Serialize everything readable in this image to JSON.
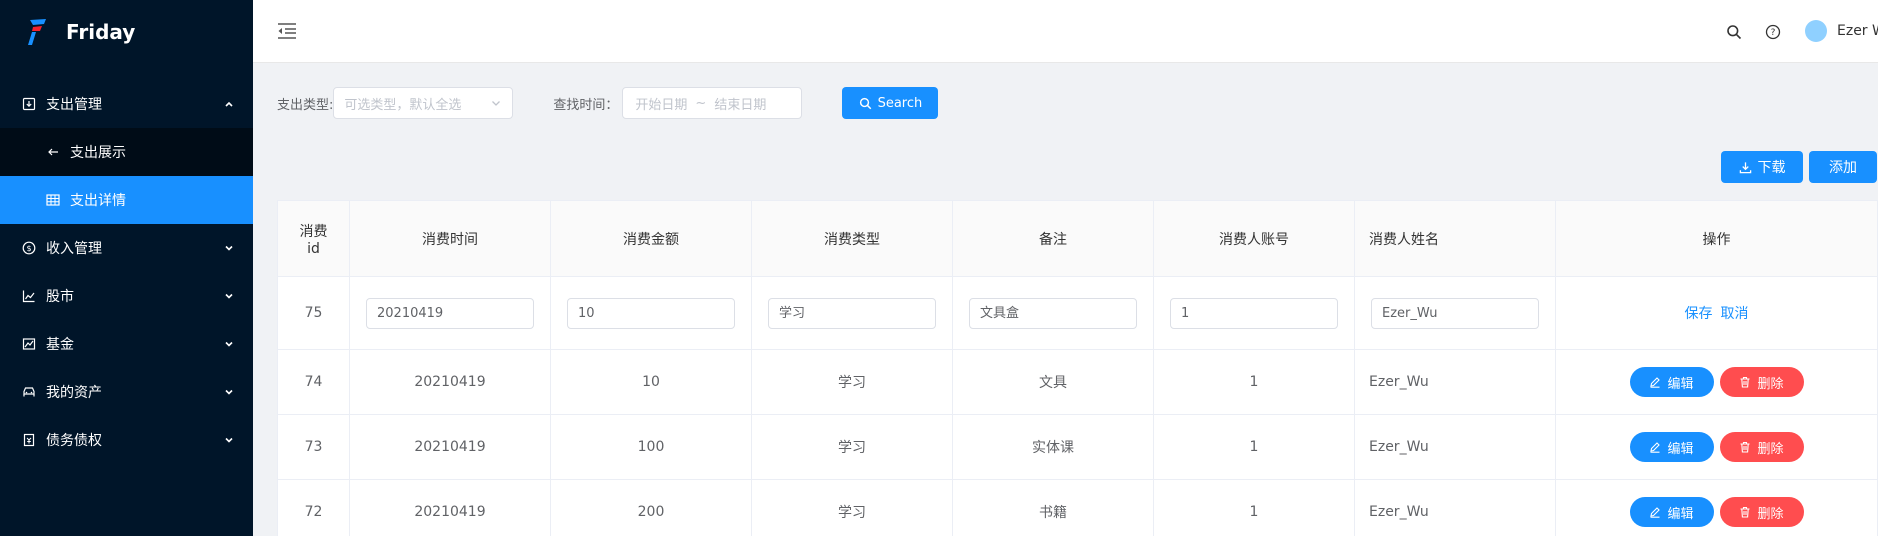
{
  "app": {
    "name": "Friday"
  },
  "sidebar": {
    "items": [
      {
        "label": "支出管理",
        "icon": "export-icon",
        "expanded": true,
        "children": [
          {
            "label": "支出展示",
            "icon": "arrow-left-icon"
          },
          {
            "label": "支出详情",
            "icon": "table-icon",
            "active": true
          }
        ]
      },
      {
        "label": "收入管理",
        "icon": "dollar-icon"
      },
      {
        "label": "股市",
        "icon": "line-chart-icon"
      },
      {
        "label": "基金",
        "icon": "area-chart-icon"
      },
      {
        "label": "我的资产",
        "icon": "car-icon"
      },
      {
        "label": "债务债权",
        "icon": "account-book-icon"
      }
    ]
  },
  "header": {
    "user": "Ezer Wu"
  },
  "filters": {
    "type_label": "支出类型:",
    "type_placeholder": "可选类型，默认全选",
    "time_label": "查找时间：",
    "start_placeholder": "开始日期",
    "separator": "~",
    "end_placeholder": "结束日期",
    "search_label": "Search"
  },
  "actions": {
    "download_label": "下载",
    "add_label": "添加"
  },
  "table": {
    "headers": [
      "消费id",
      "消费时间",
      "消费金额",
      "消费类型",
      "备注",
      "消费人账号",
      "消费人姓名",
      "操作"
    ],
    "header_id_line1": "消费",
    "header_id_line2": "id",
    "edit_row": {
      "id": "75",
      "time": "20210419",
      "amount": "10",
      "type": "学习",
      "note": "文具盒",
      "account": "1",
      "name": "Ezer_Wu",
      "save": "保存",
      "cancel": "取消"
    },
    "rows": [
      {
        "id": "74",
        "time": "20210419",
        "amount": "10",
        "type": "学习",
        "note": "文具",
        "account": "1",
        "name": "Ezer_Wu"
      },
      {
        "id": "73",
        "time": "20210419",
        "amount": "100",
        "type": "学习",
        "note": "实体课",
        "account": "1",
        "name": "Ezer_Wu"
      },
      {
        "id": "72",
        "time": "20210419",
        "amount": "200",
        "type": "学习",
        "note": "书籍",
        "account": "1",
        "name": "Ezer_Wu"
      }
    ],
    "edit_label": "编辑",
    "delete_label": "删除"
  },
  "colors": {
    "primary": "#1890ff",
    "danger": "#ff4d4f",
    "sidebar_bg": "#001529",
    "submenu_bg": "#000c17"
  }
}
